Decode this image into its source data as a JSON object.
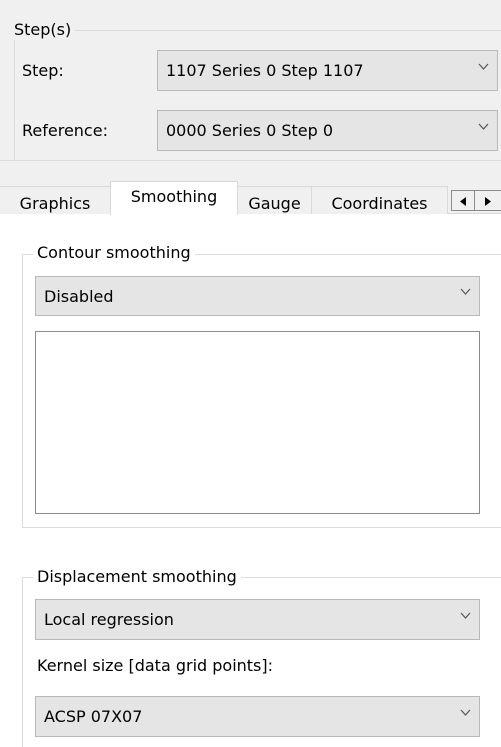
{
  "steps": {
    "group_title": "Step(s)",
    "step_label": "Step:",
    "step_value": "1107  Series 0  Step 1107",
    "reference_label": "Reference:",
    "reference_value": "0000  Series 0  Step 0"
  },
  "tabs": [
    {
      "label": "Graphics",
      "active": false
    },
    {
      "label": "Smoothing",
      "active": true
    },
    {
      "label": "Gauge",
      "active": false
    },
    {
      "label": "Coordinates",
      "active": false
    }
  ],
  "tab_scroll": {
    "left_icon": "triangle-left-icon",
    "right_icon": "triangle-right-icon"
  },
  "contour_smoothing": {
    "group_title": "Contour smoothing",
    "mode_value": "Disabled"
  },
  "displacement_smoothing": {
    "group_title": "Displacement smoothing",
    "mode_value": "Local regression",
    "kernel_label": "Kernel size [data grid points]:",
    "kernel_value": "ACSP 07X07"
  }
}
